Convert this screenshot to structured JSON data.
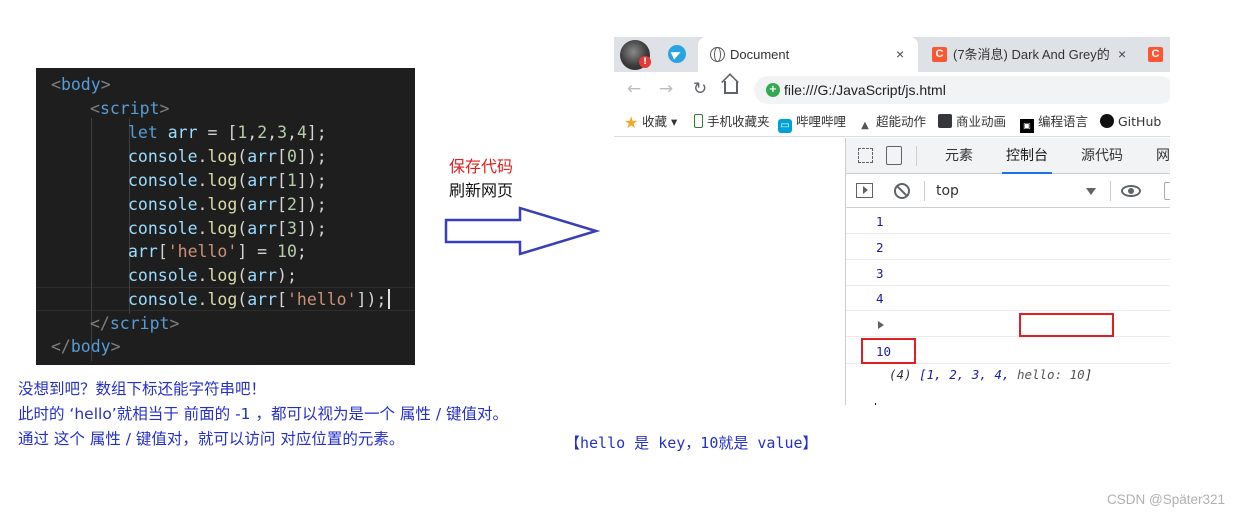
{
  "editor": {
    "lines": [
      {
        "open": "<",
        "name": "body",
        "close": ">"
      },
      {
        "open": "<",
        "name": "script",
        "close": ">"
      },
      {
        "kw": "let",
        "var": "arr",
        "text1": " = [",
        "n1": "1",
        "c1": ",",
        "n2": "2",
        "c2": ",",
        "n3": "3",
        "c3": ",",
        "n4": "4",
        "end": "];"
      },
      {
        "obj": "console",
        "fn": "log",
        "var": "arr",
        "idx": "0"
      },
      {
        "obj": "console",
        "fn": "log",
        "var": "arr",
        "idx": "1"
      },
      {
        "obj": "console",
        "fn": "log",
        "var": "arr",
        "idx": "2"
      },
      {
        "obj": "console",
        "fn": "log",
        "var": "arr",
        "idx": "3"
      },
      {
        "var": "arr",
        "str": "'hello'",
        "num": "10"
      },
      {
        "obj": "console",
        "fn": "log",
        "var": "arr"
      },
      {
        "obj": "console",
        "fn": "log",
        "var": "arr",
        "str": "'hello'"
      },
      {
        "open": "</",
        "name": "script",
        "close": ">"
      },
      {
        "open": "</",
        "name": "body",
        "close": ">"
      }
    ]
  },
  "annotations": {
    "save_code": "保存代码",
    "refresh_page": "刷新网页",
    "explanation": [
      "没想到吧？数组下标还能字符串吧！",
      "此时的 ‘hello’就相当于 前面的 -1 ，都可以视为是一个 属性 / 键值对。",
      "通过 这个 属性 / 键值对，就可以访问 对应位置的元素。"
    ],
    "key_value_note": "【hello 是 key，10就是 value】",
    "watermark": "CSDN @Später321"
  },
  "browser": {
    "tabs": [
      {
        "title": "Document",
        "close": "×"
      },
      {
        "icon_text": "C",
        "title": "(7条消息) Dark And Grey的",
        "close": "×"
      },
      {
        "icon_text": "C"
      }
    ],
    "avatar_badge": "!",
    "url": "file:///G:/JavaScript/js.html",
    "nav": {
      "back": "←",
      "forward": "→",
      "reload": "↻"
    },
    "bookmarks": [
      {
        "label": "收藏",
        "icon": "star-icon",
        "dropdown": "▾"
      },
      {
        "label": "手机收藏夹",
        "icon": "phone-icon"
      },
      {
        "label": "哔哩哔哩",
        "icon": "bilibili-icon"
      },
      {
        "label": "超能动作",
        "icon": "cat-icon"
      },
      {
        "label": "商业动画",
        "icon": "anime-icon"
      },
      {
        "label": "编程语言",
        "icon": "code-icon"
      },
      {
        "label": "GitHub",
        "icon": "github-icon"
      }
    ],
    "devtools": {
      "tabs": [
        "元素",
        "控制台",
        "源代码",
        "网"
      ],
      "active_tab": "控制台",
      "context": "top",
      "console": {
        "values": [
          "1",
          "2",
          "3",
          "4"
        ],
        "array_count": "(4)",
        "array_items": "[1, 2, 3, 4, ",
        "array_hello": "hello: 10",
        "array_end": "]",
        "hello_value": "10",
        "prompt": "›"
      }
    }
  }
}
